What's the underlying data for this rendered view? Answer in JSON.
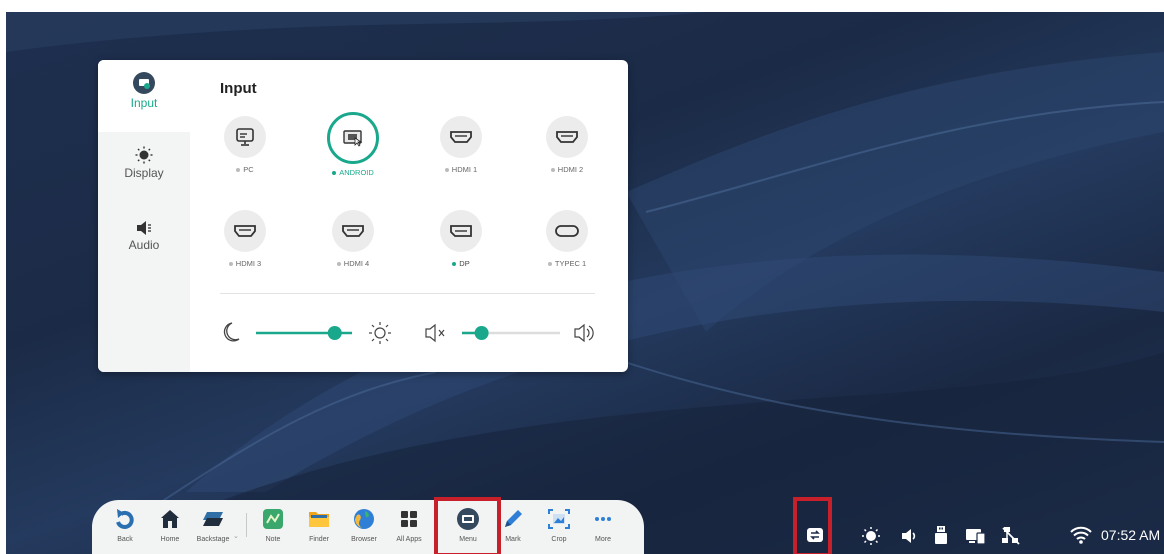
{
  "panel": {
    "title": "Input",
    "sidebar": [
      {
        "label": "Input",
        "icon": "input-icon",
        "active": true
      },
      {
        "label": "Display",
        "icon": "brightness-icon",
        "active": false
      },
      {
        "label": "Audio",
        "icon": "speaker-icon",
        "active": false
      }
    ],
    "sources": [
      {
        "label": "PC",
        "icon": "monitor-icon",
        "active": false
      },
      {
        "label": "ANDROID",
        "icon": "android-source-icon",
        "active": true
      },
      {
        "label": "HDMI 1",
        "icon": "hdmi-port-icon",
        "active": false
      },
      {
        "label": "HDMI 2",
        "icon": "hdmi-port-icon",
        "active": false
      },
      {
        "label": "HDMI 3",
        "icon": "hdmi-port-icon",
        "active": false
      },
      {
        "label": "HDMI 4",
        "icon": "hdmi-port-icon",
        "active": false
      },
      {
        "label": "DP",
        "icon": "displayport-icon",
        "active": false,
        "signal": true
      },
      {
        "label": "TYPEC 1",
        "icon": "usb-c-icon",
        "active": false
      }
    ],
    "brightness_level": 0.82,
    "volume_level": 0.2,
    "accent_color": "#1aa88c"
  },
  "dock": {
    "items": [
      {
        "label": "Back",
        "icon": "back-icon"
      },
      {
        "label": "Home",
        "icon": "home-icon"
      },
      {
        "label": "Backstage",
        "icon": "backstage-icon"
      },
      {
        "label": "Note",
        "icon": "note-app-icon"
      },
      {
        "label": "Finder",
        "icon": "folder-icon"
      },
      {
        "label": "Browser",
        "icon": "browser-icon"
      },
      {
        "label": "All Apps",
        "icon": "grid-icon"
      },
      {
        "label": "Menu",
        "icon": "menu-icon"
      },
      {
        "label": "Mark",
        "icon": "pen-icon"
      },
      {
        "label": "Crop",
        "icon": "crop-icon"
      },
      {
        "label": "More",
        "icon": "more-icon"
      }
    ]
  },
  "tray": {
    "icons": [
      "input-switch-icon",
      "brightness-icon",
      "volume-icon",
      "usb-icon",
      "screen-share-icon",
      "network-disconnected-icon",
      "wifi-icon"
    ],
    "time": "07:52 AM"
  },
  "highlight_color": "#c8202a"
}
